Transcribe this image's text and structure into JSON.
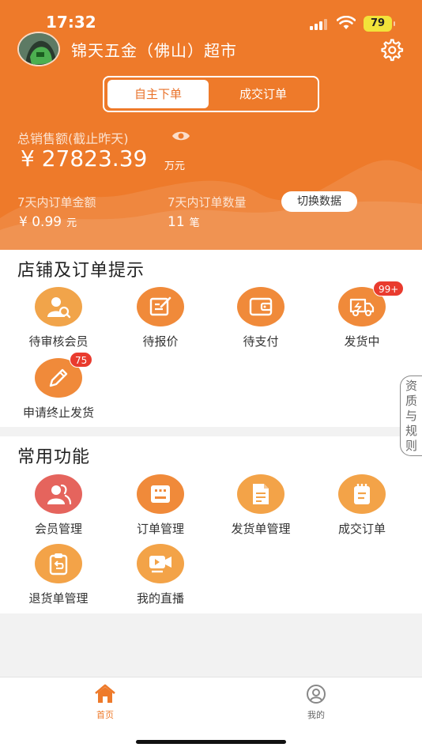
{
  "status_bar": {
    "time": "17:32",
    "battery": "79"
  },
  "header": {
    "store_name": "锦天五金（佛山）超市",
    "tabs": {
      "active": "自主下单",
      "inactive": "成交订单"
    },
    "total_sales_label": "总销售额(截止昨天)",
    "total_sales_value": "¥ 27823.39",
    "total_sales_unit": "万元",
    "order_amount_label": "7天内订单金额",
    "order_amount_value": "¥ 0.99",
    "order_amount_unit": "元",
    "order_count_label": "7天内订单数量",
    "order_count_value": "11",
    "order_count_unit": "笔",
    "switch_label": "切换数据"
  },
  "store_tips": {
    "title": "店铺及订单提示",
    "items": [
      {
        "label": "待审核会员",
        "icon": "member-search-icon"
      },
      {
        "label": "待报价",
        "icon": "edit-note-icon"
      },
      {
        "label": "待支付",
        "icon": "wallet-icon"
      },
      {
        "label": "发货中",
        "icon": "truck-icon",
        "badge": "99+"
      },
      {
        "label": "申请终止发货",
        "icon": "pencil-icon",
        "badge": "75"
      }
    ]
  },
  "side_tab": {
    "label": "资质与规则"
  },
  "common_functions": {
    "title": "常用功能",
    "items": [
      {
        "label": "会员管理",
        "icon": "members-icon"
      },
      {
        "label": "订单管理",
        "icon": "order-list-icon"
      },
      {
        "label": "发货单管理",
        "icon": "document-icon"
      },
      {
        "label": "成交订单",
        "icon": "notepad-icon"
      },
      {
        "label": "退货单管理",
        "icon": "return-clipboard-icon"
      },
      {
        "label": "我的直播",
        "icon": "video-camera-icon"
      }
    ]
  },
  "tabbar": {
    "home": "首页",
    "mine": "我的",
    "active_color": "#ee7a2a"
  },
  "colors": {
    "brand": "#ee7a2a",
    "badge": "#e93b2e"
  }
}
